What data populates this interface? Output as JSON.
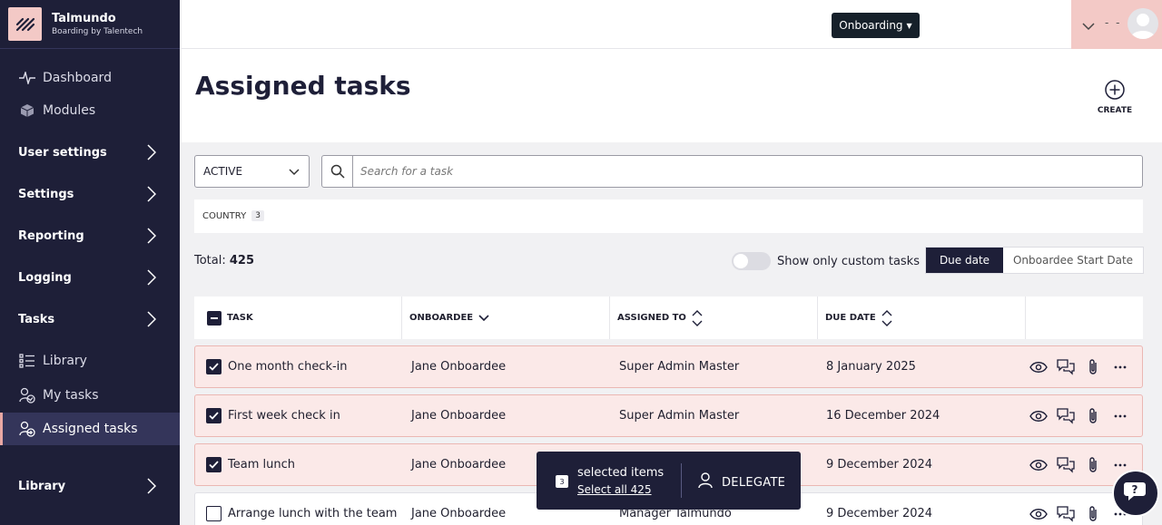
{
  "brand": {
    "name": "Talmundo",
    "subtitle": "Boarding by Talentech"
  },
  "sidebar": {
    "items": [
      {
        "label": "Dashboard",
        "icon": "pulse-icon"
      },
      {
        "label": "Modules",
        "icon": "cube-icon"
      },
      {
        "label": "User settings",
        "section": true
      },
      {
        "label": "Settings",
        "section": true
      },
      {
        "label": "Reporting",
        "section": true
      },
      {
        "label": "Logging",
        "section": true
      },
      {
        "label": "Tasks",
        "section": true
      },
      {
        "label": "Library",
        "icon": "list-icon"
      },
      {
        "label": "My tasks",
        "icon": "user-check-icon"
      },
      {
        "label": "Assigned tasks",
        "icon": "user-plus-icon",
        "active": true
      },
      {
        "label": "Library",
        "section": true
      }
    ]
  },
  "topbar": {
    "context_button": "Onboarding",
    "user_dashes": "- -"
  },
  "page": {
    "title": "Assigned tasks",
    "create_label": "CREATE"
  },
  "filters": {
    "status_value": "ACTIVE",
    "search_placeholder": "Search for a task",
    "country_label": "COUNTRY",
    "country_count": "3"
  },
  "summary": {
    "total_label": "Total:",
    "total_value": "425",
    "toggle_label": "Show only custom tasks",
    "segment_on": "Due date",
    "segment_off": "Onboardee Start Date"
  },
  "table": {
    "headers": [
      "TASK",
      "ONBOARDEE",
      "ASSIGNED TO",
      "DUE DATE"
    ],
    "rows": [
      {
        "task": "One month check-in",
        "onboardee": "Jane Onboardee",
        "assigned_to": "Super Admin Master",
        "due": "8 January 2025",
        "checked": true
      },
      {
        "task": "First week check in",
        "onboardee": "Jane Onboardee",
        "assigned_to": "Super Admin Master",
        "due": "16 December 2024",
        "checked": true
      },
      {
        "task": "Team lunch",
        "onboardee": "Jane Onboardee",
        "assigned_to": "",
        "due": "9 December 2024",
        "checked": true
      },
      {
        "task": "Arrange lunch with the team",
        "onboardee": "Jane Onboardee",
        "assigned_to": "Manager Talmundo",
        "due": "9 December 2024",
        "checked": false
      }
    ]
  },
  "toast": {
    "count": "3",
    "selected_label": "selected items",
    "select_all": "Select all 425",
    "action": "DELEGATE"
  },
  "colors": {
    "sidebar_bg": "#1e1f38",
    "accent_pink": "#f3c9c6",
    "row_selected_bg": "#fbe9e8",
    "row_selected_border": "#ebb7b3"
  }
}
